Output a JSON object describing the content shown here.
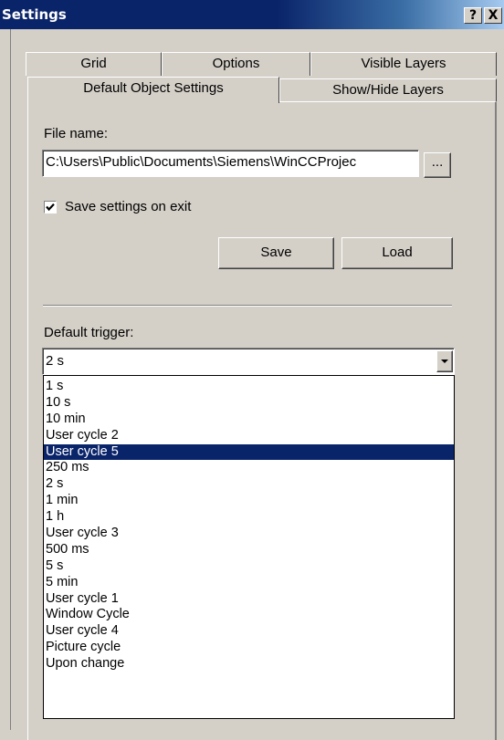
{
  "window": {
    "title": "Settings",
    "help_button": "?",
    "close_button": "X"
  },
  "tabs": {
    "row_back": [
      "Grid",
      "Options",
      "Visible Layers"
    ],
    "row_front": [
      "Default Object Settings",
      "Show/Hide Layers"
    ],
    "active": "Default Object Settings"
  },
  "file": {
    "label": "File name:",
    "value": "C:\\Users\\Public\\Documents\\Siemens\\WinCCProjec",
    "browse_label": "..."
  },
  "save_on_exit": {
    "label": "Save settings on exit",
    "checked": true
  },
  "buttons": {
    "save": "Save",
    "load": "Load"
  },
  "trigger": {
    "label": "Default trigger:",
    "selected": "2 s",
    "highlighted": "User cycle 5",
    "options": [
      "1 s",
      "10 s",
      "10 min",
      "User cycle 2",
      "User cycle 5",
      "250 ms",
      "2 s",
      "1 min",
      "1 h",
      "User cycle 3",
      "500 ms",
      "5 s",
      "5 min",
      "User cycle 1",
      "Window Cycle",
      "User cycle 4",
      "Picture cycle",
      "Upon change"
    ]
  },
  "colors": {
    "titlebar": "#0a246a",
    "face": "#d4d0c8",
    "highlight": "#0a246a"
  }
}
